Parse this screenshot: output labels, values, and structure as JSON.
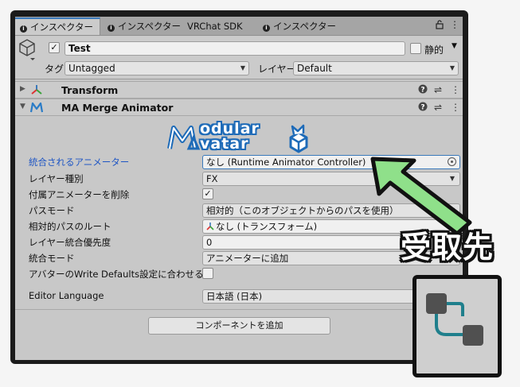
{
  "tabs": [
    {
      "label": "インスペクター",
      "info": "i",
      "active": true
    },
    {
      "label": "インスペクター",
      "info": "i",
      "active": false
    },
    {
      "label": "VRChat SDK",
      "info": "",
      "active": false
    },
    {
      "label": "インスペクター",
      "info": "i",
      "active": false
    }
  ],
  "header": {
    "object_name": "Test",
    "active_checked": "✓",
    "static_label": "静的",
    "tag_label": "タグ",
    "tag_value": "Untagged",
    "layer_label": "レイヤー",
    "layer_value": "Default"
  },
  "components": {
    "transform": {
      "name": "Transform"
    },
    "merge_animator": {
      "name": "MA Merge Animator"
    }
  },
  "logo": {
    "line1": "odular",
    "line2": "vatar"
  },
  "fields": [
    {
      "label": "統合されるアニメーター",
      "value": "なし (Runtime Animator Controller)"
    },
    {
      "label": "レイヤー種別",
      "value": "FX"
    },
    {
      "label": "付属アニメーターを削除",
      "value": "✓"
    },
    {
      "label": "パスモード",
      "value": "相対的（このオブジェクトからのパスを使用）"
    },
    {
      "label": "相対的パスのルート",
      "value": "なし (トランスフォーム)"
    },
    {
      "label": "レイヤー統合優先度",
      "value": "0"
    },
    {
      "label": "統合モード",
      "value": "アニメーターに追加"
    },
    {
      "label": "アバターのWrite Defaults設定に合わせる",
      "value": ""
    },
    {
      "label": "Editor Language",
      "value": "日本語 (日本)"
    }
  ],
  "add_component_label": "コンポーネントを追加",
  "annotation": {
    "label": "受取先"
  },
  "colors": {
    "accent_link": "#1f56c4",
    "arrow_fill": "#8fe08a",
    "tab_highlight": "#3a79bb",
    "icon_teal": "#1f7f8c"
  }
}
